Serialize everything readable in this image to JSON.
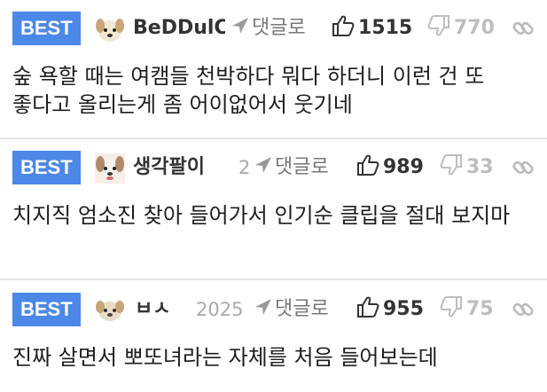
{
  "colors": {
    "best_badge": "#4b88e8",
    "like": "#333333",
    "dislike": "#bdbdbd",
    "divider": "#e4e4e4"
  },
  "icons": {
    "reply": "reply-arrow-icon",
    "like": "thumbs-up-icon",
    "dislike": "thumbs-down-icon",
    "link": "chain-link-icon"
  },
  "comments": [
    {
      "badge": "BEST",
      "nickname": "BeDDulC",
      "date": "",
      "reply_label": "댓글로",
      "likes": "1515",
      "dislikes": "770",
      "text": "숲 욕할 때는 여캠들 천박하다 뭐다 하더니 이런 건 또 좋다고 올리는게 좀 어이없어서 웃기네"
    },
    {
      "badge": "BEST",
      "nickname": "생각팔이",
      "date": "2",
      "reply_label": "댓글로",
      "likes": "989",
      "dislikes": "33",
      "text": "치지직 엄소진 찾아 들어가서 인기순 클립을 절대 보지마"
    },
    {
      "badge": "BEST",
      "nickname": "ㅂㅅ",
      "date": "2025",
      "reply_label": "댓글로",
      "likes": "955",
      "dislikes": "75",
      "text": "진짜 살면서 뽀또녀라는 자체를 처음 들어보는데"
    }
  ]
}
